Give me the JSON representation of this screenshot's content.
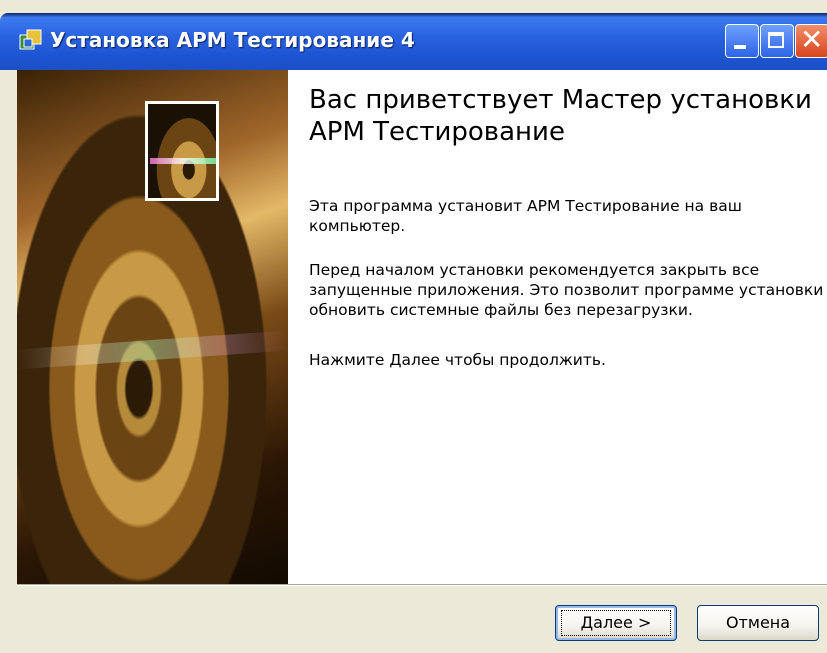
{
  "window": {
    "title": "Установка АРМ Тестирование 4",
    "icon": "installer-icon",
    "caption_buttons": [
      "minimize-icon",
      "maximize-icon",
      "close-icon"
    ]
  },
  "content": {
    "heading": "Вас приветствует Мастер установки АРМ Тестирование",
    "paragraph1": "Эта программа установит АРМ Тестирование на ваш компьютер.",
    "paragraph2": "Перед началом установки рекомендуется закрыть все запущенные приложения. Это позволит программе установки обновить системные файлы без перезагрузки.",
    "paragraph3": "Нажмите Далее чтобы продолжить."
  },
  "buttons": {
    "next_label": "Далее >",
    "cancel_label": "Отмена"
  },
  "colors": {
    "titlebar": "#2a63e0",
    "close_button": "#d8441c",
    "dialog_background": "#ece9d8"
  }
}
